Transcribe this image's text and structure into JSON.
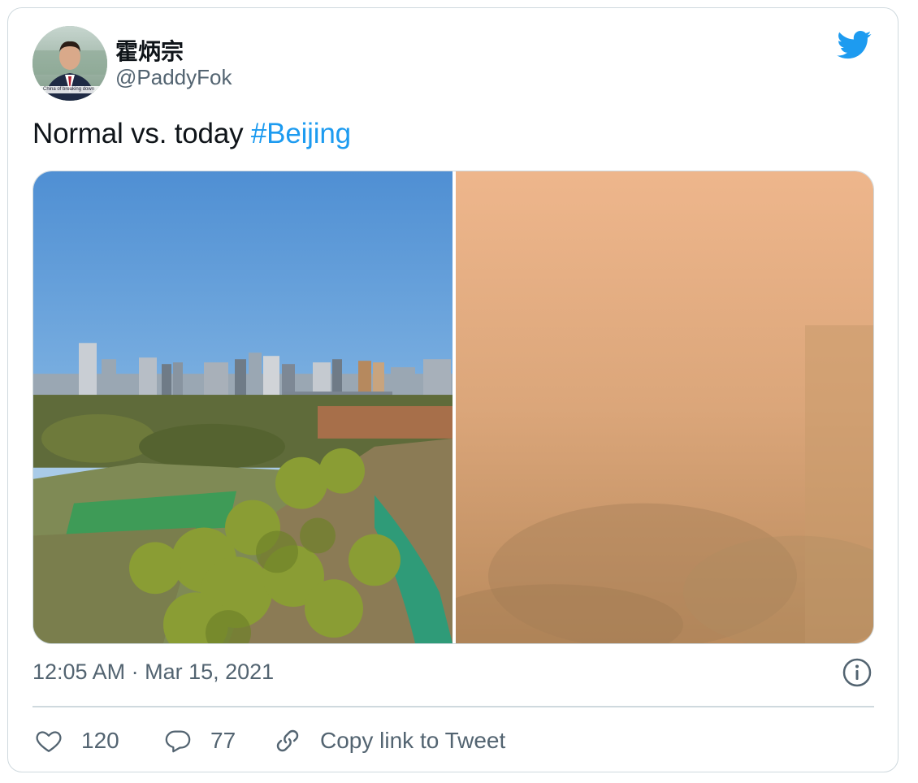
{
  "author": {
    "name": "霍炳宗",
    "handle": "@PaddyFok",
    "avatar_caption": "China of breaking down"
  },
  "tweet": {
    "text": "Normal vs. today ",
    "hashtag": "#Beijing"
  },
  "media": {
    "left_image": "clear-sky-city-park-photo",
    "right_image": "sandstorm-haze-photo"
  },
  "meta": {
    "timestamp": "12:05 AM · Mar 15, 2021"
  },
  "actions": {
    "like_count": "120",
    "reply_count": "77",
    "copy_link_label": "Copy link to Tweet"
  },
  "colors": {
    "accent": "#1d9bf0",
    "secondary_text": "#536471",
    "border": "#cfd9de",
    "like_red": "#f91880"
  },
  "icons": [
    "twitter-bird-icon",
    "info-icon",
    "heart-icon",
    "reply-bubble-icon",
    "link-icon"
  ]
}
